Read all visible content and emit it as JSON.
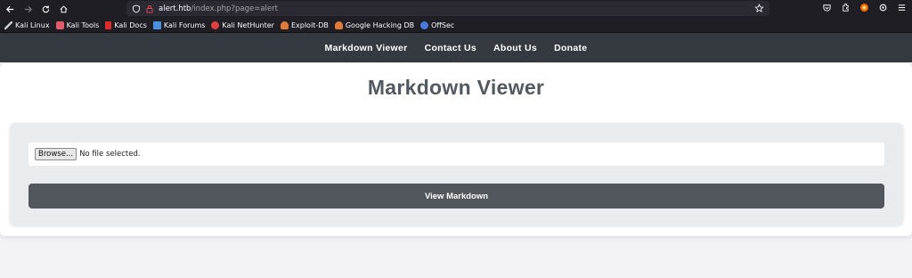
{
  "browser": {
    "url_host": "alert.htb",
    "url_path": "/index.php?page=alert",
    "bookmarks": [
      {
        "label": "Kali Linux",
        "color": "#9aa0a6"
      },
      {
        "label": "Kali Tools",
        "color": "#e45c6a"
      },
      {
        "label": "Kali Docs",
        "color": "#e02b2b"
      },
      {
        "label": "Kali Forums",
        "color": "#4a8fe0"
      },
      {
        "label": "Kali NetHunter",
        "color": "#e04040"
      },
      {
        "label": "Exploit-DB",
        "color": "#e07a3a"
      },
      {
        "label": "Google Hacking DB",
        "color": "#e07a3a"
      },
      {
        "label": "OffSec",
        "color": "#4a7ae0"
      }
    ]
  },
  "site_nav": {
    "items": [
      "Markdown Viewer",
      "Contact Us",
      "About Us",
      "Donate"
    ]
  },
  "main": {
    "title": "Markdown Viewer",
    "file_input": {
      "button_label": "Browse...",
      "status": "No file selected."
    },
    "submit_label": "View Markdown"
  },
  "colors": {
    "nav_bg": "#353a41",
    "button_bg": "#52565d",
    "panel_bg": "#e9ecef"
  }
}
